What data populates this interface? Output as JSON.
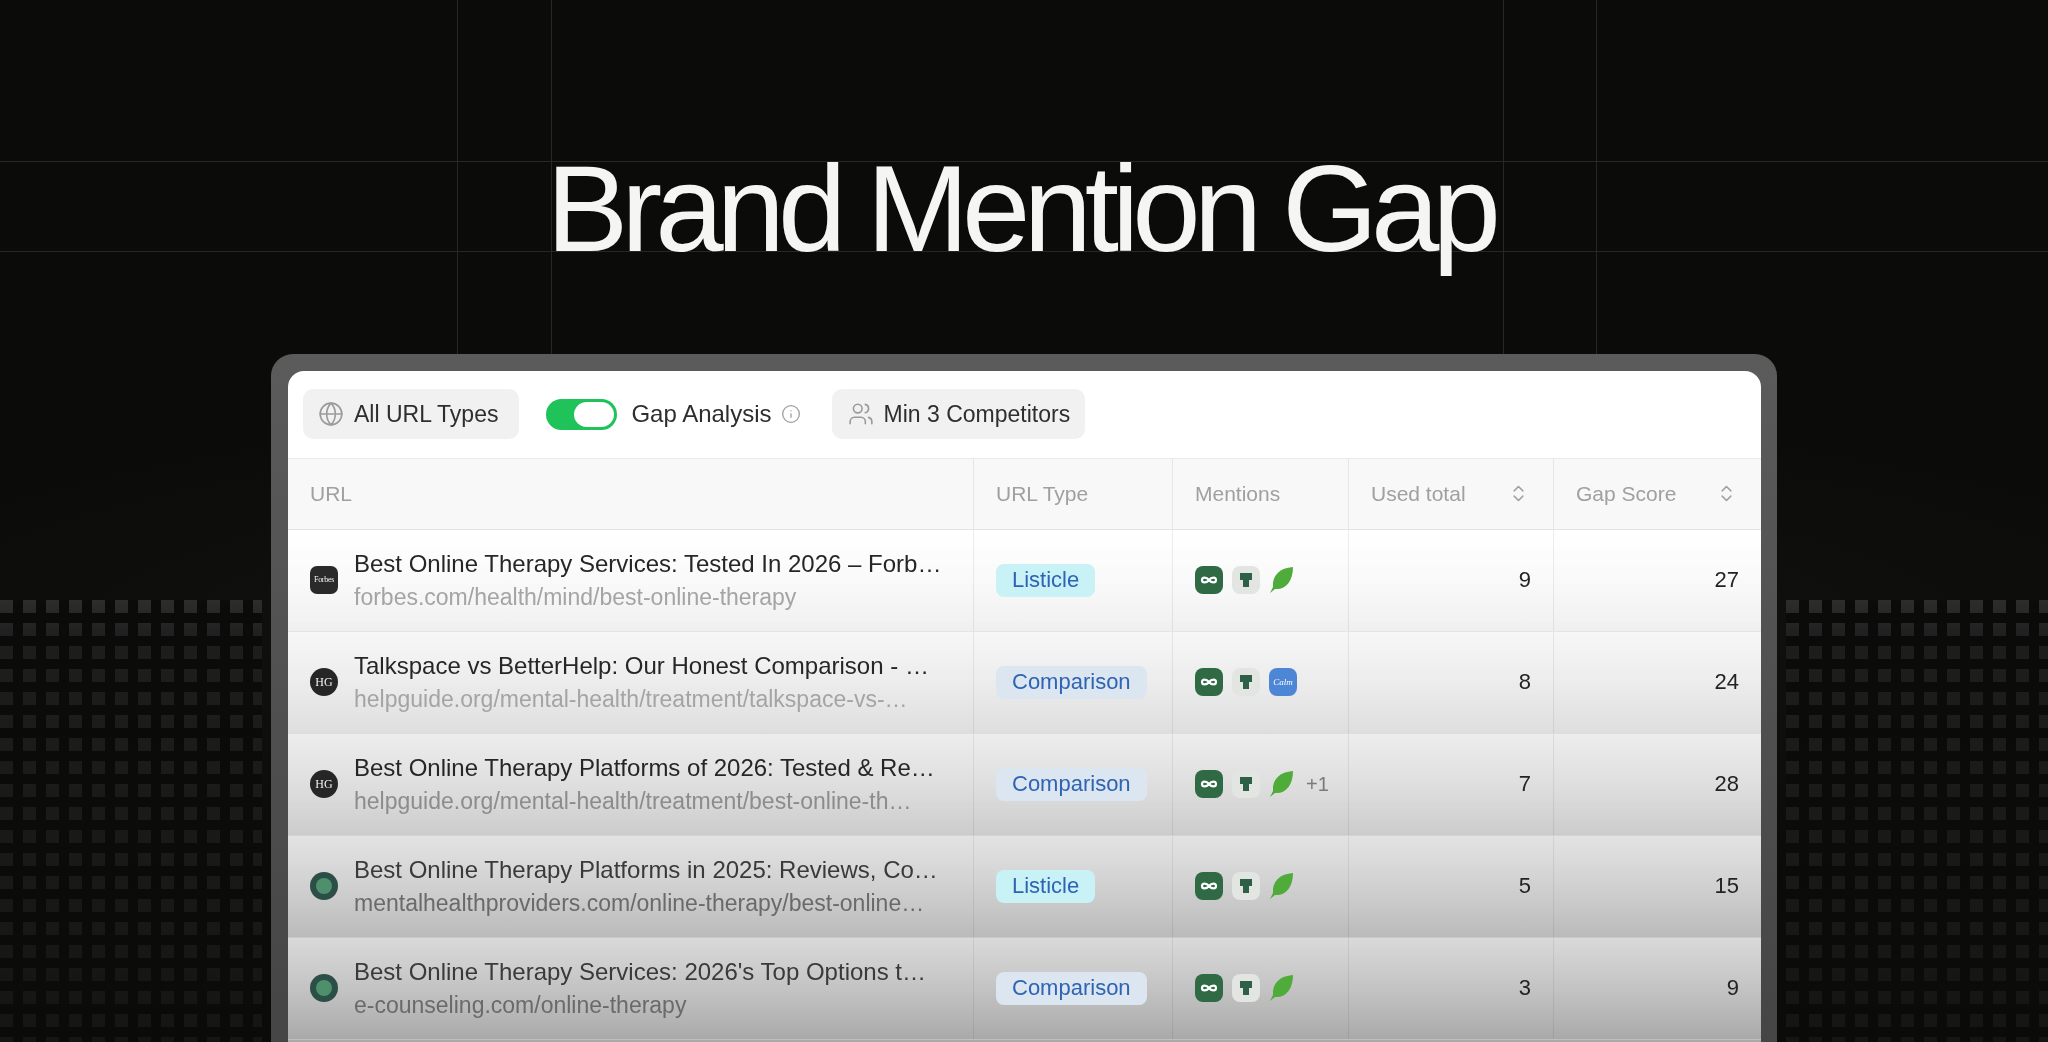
{
  "title": "Brand Mention Gap",
  "toolbar": {
    "url_type_filter": {
      "label": "All URL Types"
    },
    "gap_analysis": {
      "label": "Gap Analysis",
      "on": true
    },
    "competitor_filter": {
      "label": "Min 3 Competitors"
    }
  },
  "table": {
    "columns": [
      {
        "label": "URL",
        "sortable": false
      },
      {
        "label": "URL Type",
        "sortable": false
      },
      {
        "label": "Mentions",
        "sortable": false
      },
      {
        "label": "Used total",
        "sortable": true
      },
      {
        "label": "Gap Score",
        "sortable": true
      }
    ],
    "rows": [
      {
        "favicon": {
          "kind": "tile",
          "text": "Forbes"
        },
        "title": "Best Online Therapy Services: Tested In 2026 – Forb…",
        "url": "forbes.com/health/mind/best-online-therapy",
        "type": {
          "label": "Listicle",
          "color": "#c9f2f6"
        },
        "mentions": [
          {
            "kind": "loop"
          },
          {
            "kind": "cup"
          },
          {
            "kind": "leaf"
          }
        ],
        "used_total": "9",
        "gap_score": "27"
      },
      {
        "favicon": {
          "kind": "disc",
          "text": "HG"
        },
        "title": "Talkspace vs BetterHelp: Our Honest Comparison - …",
        "url": "helpguide.org/mental-health/treatment/talkspace-vs-…",
        "type": {
          "label": "Comparison",
          "color": "#dbe6f0"
        },
        "mentions": [
          {
            "kind": "loop"
          },
          {
            "kind": "cup"
          },
          {
            "kind": "wordmark",
            "text": "Calm"
          }
        ],
        "used_total": "8",
        "gap_score": "24"
      },
      {
        "favicon": {
          "kind": "disc",
          "text": "HG"
        },
        "title": "Best Online Therapy Platforms of 2026: Tested & Re…",
        "url": "helpguide.org/mental-health/treatment/best-online-th…",
        "type": {
          "label": "Comparison",
          "color": "#dbe6f0"
        },
        "mentions": [
          {
            "kind": "loop"
          },
          {
            "kind": "cup"
          },
          {
            "kind": "leaf"
          }
        ],
        "more": "+1",
        "used_total": "7",
        "gap_score": "28"
      },
      {
        "favicon": {
          "kind": "picture"
        },
        "title": "Best Online Therapy Platforms in 2025: Reviews, Co…",
        "url": "mentalhealthproviders.com/online-therapy/best-online…",
        "type": {
          "label": "Listicle",
          "color": "#c9f2f6"
        },
        "mentions": [
          {
            "kind": "loop"
          },
          {
            "kind": "cup"
          },
          {
            "kind": "leaf"
          }
        ],
        "used_total": "5",
        "gap_score": "15"
      },
      {
        "favicon": {
          "kind": "picture"
        },
        "title": "Best Online Therapy Services: 2026's Top Options t…",
        "url": "e-counseling.com/online-therapy",
        "type": {
          "label": "Comparison",
          "color": "#dbe6f0"
        },
        "mentions": [
          {
            "kind": "loop"
          },
          {
            "kind": "cup"
          },
          {
            "kind": "leaf"
          }
        ],
        "used_total": "3",
        "gap_score": "9"
      }
    ]
  }
}
